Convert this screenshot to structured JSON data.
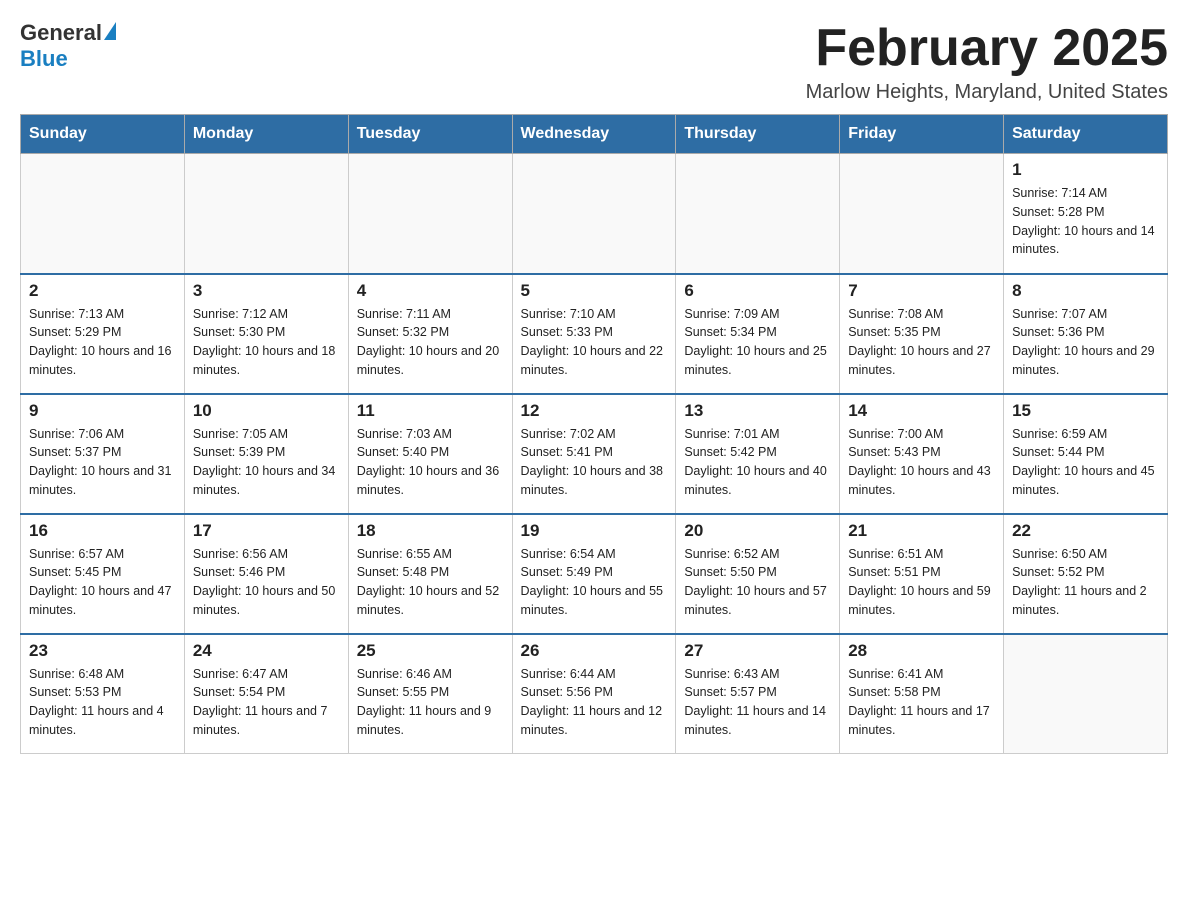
{
  "header": {
    "logo_general": "General",
    "logo_blue": "Blue",
    "month_title": "February 2025",
    "location": "Marlow Heights, Maryland, United States"
  },
  "weekdays": [
    "Sunday",
    "Monday",
    "Tuesday",
    "Wednesday",
    "Thursday",
    "Friday",
    "Saturday"
  ],
  "weeks": [
    [
      {
        "day": "",
        "info": ""
      },
      {
        "day": "",
        "info": ""
      },
      {
        "day": "",
        "info": ""
      },
      {
        "day": "",
        "info": ""
      },
      {
        "day": "",
        "info": ""
      },
      {
        "day": "",
        "info": ""
      },
      {
        "day": "1",
        "info": "Sunrise: 7:14 AM\nSunset: 5:28 PM\nDaylight: 10 hours and 14 minutes."
      }
    ],
    [
      {
        "day": "2",
        "info": "Sunrise: 7:13 AM\nSunset: 5:29 PM\nDaylight: 10 hours and 16 minutes."
      },
      {
        "day": "3",
        "info": "Sunrise: 7:12 AM\nSunset: 5:30 PM\nDaylight: 10 hours and 18 minutes."
      },
      {
        "day": "4",
        "info": "Sunrise: 7:11 AM\nSunset: 5:32 PM\nDaylight: 10 hours and 20 minutes."
      },
      {
        "day": "5",
        "info": "Sunrise: 7:10 AM\nSunset: 5:33 PM\nDaylight: 10 hours and 22 minutes."
      },
      {
        "day": "6",
        "info": "Sunrise: 7:09 AM\nSunset: 5:34 PM\nDaylight: 10 hours and 25 minutes."
      },
      {
        "day": "7",
        "info": "Sunrise: 7:08 AM\nSunset: 5:35 PM\nDaylight: 10 hours and 27 minutes."
      },
      {
        "day": "8",
        "info": "Sunrise: 7:07 AM\nSunset: 5:36 PM\nDaylight: 10 hours and 29 minutes."
      }
    ],
    [
      {
        "day": "9",
        "info": "Sunrise: 7:06 AM\nSunset: 5:37 PM\nDaylight: 10 hours and 31 minutes."
      },
      {
        "day": "10",
        "info": "Sunrise: 7:05 AM\nSunset: 5:39 PM\nDaylight: 10 hours and 34 minutes."
      },
      {
        "day": "11",
        "info": "Sunrise: 7:03 AM\nSunset: 5:40 PM\nDaylight: 10 hours and 36 minutes."
      },
      {
        "day": "12",
        "info": "Sunrise: 7:02 AM\nSunset: 5:41 PM\nDaylight: 10 hours and 38 minutes."
      },
      {
        "day": "13",
        "info": "Sunrise: 7:01 AM\nSunset: 5:42 PM\nDaylight: 10 hours and 40 minutes."
      },
      {
        "day": "14",
        "info": "Sunrise: 7:00 AM\nSunset: 5:43 PM\nDaylight: 10 hours and 43 minutes."
      },
      {
        "day": "15",
        "info": "Sunrise: 6:59 AM\nSunset: 5:44 PM\nDaylight: 10 hours and 45 minutes."
      }
    ],
    [
      {
        "day": "16",
        "info": "Sunrise: 6:57 AM\nSunset: 5:45 PM\nDaylight: 10 hours and 47 minutes."
      },
      {
        "day": "17",
        "info": "Sunrise: 6:56 AM\nSunset: 5:46 PM\nDaylight: 10 hours and 50 minutes."
      },
      {
        "day": "18",
        "info": "Sunrise: 6:55 AM\nSunset: 5:48 PM\nDaylight: 10 hours and 52 minutes."
      },
      {
        "day": "19",
        "info": "Sunrise: 6:54 AM\nSunset: 5:49 PM\nDaylight: 10 hours and 55 minutes."
      },
      {
        "day": "20",
        "info": "Sunrise: 6:52 AM\nSunset: 5:50 PM\nDaylight: 10 hours and 57 minutes."
      },
      {
        "day": "21",
        "info": "Sunrise: 6:51 AM\nSunset: 5:51 PM\nDaylight: 10 hours and 59 minutes."
      },
      {
        "day": "22",
        "info": "Sunrise: 6:50 AM\nSunset: 5:52 PM\nDaylight: 11 hours and 2 minutes."
      }
    ],
    [
      {
        "day": "23",
        "info": "Sunrise: 6:48 AM\nSunset: 5:53 PM\nDaylight: 11 hours and 4 minutes."
      },
      {
        "day": "24",
        "info": "Sunrise: 6:47 AM\nSunset: 5:54 PM\nDaylight: 11 hours and 7 minutes."
      },
      {
        "day": "25",
        "info": "Sunrise: 6:46 AM\nSunset: 5:55 PM\nDaylight: 11 hours and 9 minutes."
      },
      {
        "day": "26",
        "info": "Sunrise: 6:44 AM\nSunset: 5:56 PM\nDaylight: 11 hours and 12 minutes."
      },
      {
        "day": "27",
        "info": "Sunrise: 6:43 AM\nSunset: 5:57 PM\nDaylight: 11 hours and 14 minutes."
      },
      {
        "day": "28",
        "info": "Sunrise: 6:41 AM\nSunset: 5:58 PM\nDaylight: 11 hours and 17 minutes."
      },
      {
        "day": "",
        "info": ""
      }
    ]
  ]
}
